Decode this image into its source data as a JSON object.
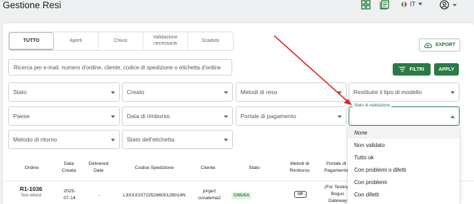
{
  "header": {
    "title": "Gestione Resi",
    "lang": "IT"
  },
  "tabs": [
    {
      "label": "TUTTO",
      "active": true
    },
    {
      "label": "Aperti"
    },
    {
      "label": "Chiusi"
    },
    {
      "label": "Validazione necessaria"
    },
    {
      "label": "Scaduto"
    }
  ],
  "toolbar": {
    "export_label": "EXPORT",
    "filtri_label": "FILTRI",
    "applica_label": "APPLY"
  },
  "search": {
    "placeholder": "Ricerca per e-mail, numero d'ordine, cliente, codice di spedizione o etichetta d'ordine"
  },
  "filters": {
    "stato": "Stato",
    "creato": "Creato",
    "metodi_reso": "Metodi di reso",
    "tipo_modello": "Restituire il tipo di modello",
    "paese": "Paese",
    "data_rimborso": "Data di rimborso",
    "portale_pagamento": "Portale di pagamento",
    "stato_validazione_label": "Stato di validazione",
    "metodo_ritorno": "Metodo di ritorno",
    "stato_etichetta": "Stato dell'etichetta"
  },
  "dropdown": {
    "options": [
      "None",
      "Non validato",
      "Tutto ok",
      "Con problemi o difetti",
      "Con problemi",
      "Con difetti"
    ]
  },
  "table": {
    "headers": {
      "ordine": "Ordine",
      "data_creata_1": "Data",
      "data_creata_2": "Creata",
      "delivered_1": "Delivered",
      "delivered_2": "Date",
      "codice": "Codice Spedizione",
      "cliente": "Cliente",
      "stato": "Stato",
      "metodi_1": "Metodi di",
      "metodi_2": "Rimborso",
      "portale_1": "Portale di",
      "portale_2": "Pagamento"
    },
    "row": {
      "order_id": "R1-1036",
      "order_sub": "Test refund",
      "date_1": "2025-",
      "date_2": "07-14",
      "delivered": "-",
      "codice": "L3XXX10722526600128014N",
      "cliente_1": "jorge2",
      "cliente_2": "cunalema2",
      "stato": "CHIUSA",
      "metodi": "OP",
      "portale_1": "(For Testing)",
      "portale_2": "Bogus",
      "portale_3": "Gateway"
    }
  },
  "colors": {
    "brand_green": "#2a7a46",
    "annotation_arrow": "#e0201c"
  }
}
